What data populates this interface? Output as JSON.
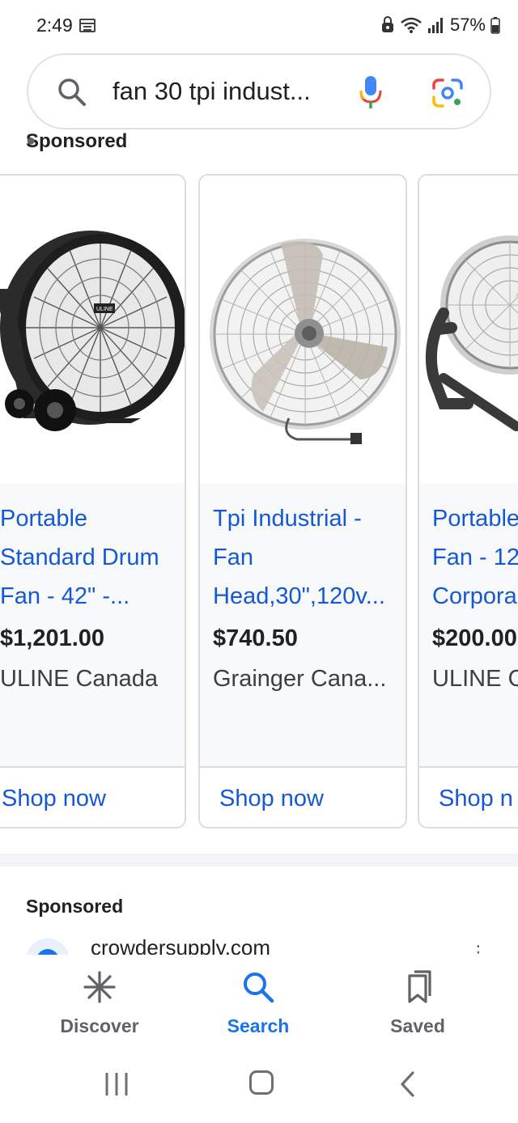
{
  "status_bar": {
    "time": "2:49",
    "battery": "57%"
  },
  "search": {
    "query": "fan 30 tpi indust..."
  },
  "section_label": "Sponsored",
  "products": [
    {
      "title_lines": [
        "Portable",
        "Standard Drum",
        "Fan - 42\" -..."
      ],
      "price": "$1,201.00",
      "seller": "ULINE Canada",
      "cta": "Shop now"
    },
    {
      "title_lines": [
        "Tpi Industrial -",
        "Fan",
        "Head,30\",120v..."
      ],
      "price": "$740.50",
      "seller": "Grainger Cana...",
      "cta": "Shop now"
    },
    {
      "title_lines": [
        "Portable",
        "Fan - 12",
        "Corpora"
      ],
      "price": "$200.00",
      "seller": "ULINE C",
      "cta": "Shop n"
    }
  ],
  "sponsored_ad": {
    "label": "Sponsored",
    "site": "crowdersupply.com"
  },
  "bottom_nav": {
    "items": [
      {
        "label": "Discover",
        "icon": "asterisk-icon",
        "active": false
      },
      {
        "label": "Search",
        "icon": "search-icon",
        "active": true
      },
      {
        "label": "Saved",
        "icon": "bookmarks-icon",
        "active": false
      }
    ]
  },
  "colors": {
    "link": "#1558d6",
    "active_nav": "#1a73e8",
    "text": "#202124",
    "card_border": "#dadce0"
  }
}
